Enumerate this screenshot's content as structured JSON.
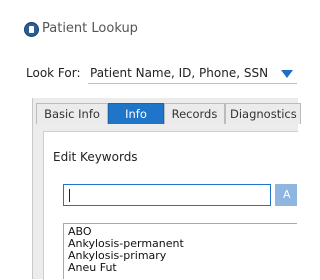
{
  "window": {
    "title": "Patient Lookup",
    "icon": "patient-lookup-icon"
  },
  "lookup": {
    "label": "Look For:",
    "value": "Patient Name, ID, Phone, SSN"
  },
  "tabs": [
    {
      "label": "Basic Info",
      "active": false
    },
    {
      "label": "Info",
      "active": true
    },
    {
      "label": "Records",
      "active": false
    },
    {
      "label": "Diagnostics",
      "active": false
    }
  ],
  "keywords_panel": {
    "title": "Edit Keywords",
    "input_value": "",
    "add_button_label": "A",
    "items": [
      "ABO",
      "Ankylosis-permanent",
      "Ankylosis-primary",
      "Aneu Fut"
    ]
  },
  "colors": {
    "accent": "#1f75c8",
    "arrow": "#1f6ec4",
    "app_icon": "#2a5d96"
  }
}
